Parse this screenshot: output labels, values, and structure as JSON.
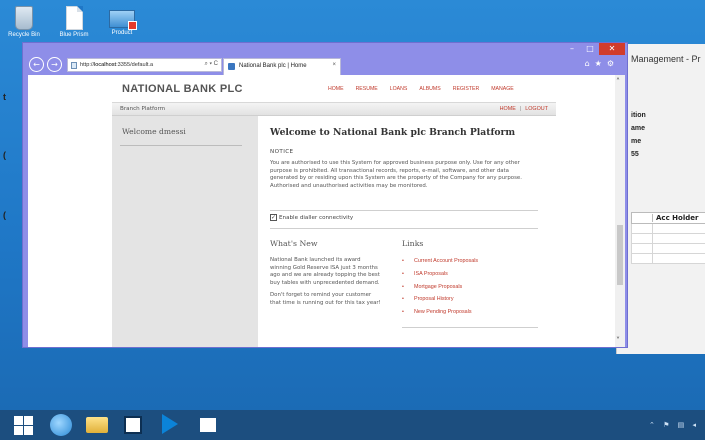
{
  "desktop": {
    "icons": [
      {
        "label": "Recycle Bin"
      },
      {
        "label": "Blue Prism"
      },
      {
        "label": "Product"
      }
    ]
  },
  "background_app": {
    "title": "Management - Pr",
    "words": [
      "ition",
      "ame",
      "me",
      "55"
    ],
    "grid_header": "Acc Holder"
  },
  "browser": {
    "address": {
      "prefix": "http://",
      "host": "localhost",
      "path": ":3355/default.a",
      "tools": "⌕ ▾ C"
    },
    "tab_title": "National Bank plc | Home",
    "tab_close": "×",
    "window_controls": {
      "minimize": "–",
      "maximize": "□",
      "close": "✕"
    },
    "nav": {
      "back": "←",
      "forward": "→"
    },
    "toolbar_icons": "⌂★⚙"
  },
  "site": {
    "logo": "NATIONAL BANK PLC",
    "nav": [
      "HOME",
      "RESUME",
      "LOANS",
      "ALBUMS",
      "REGISTER",
      "MANAGE"
    ],
    "subbar": {
      "brand": "Branch Platform",
      "home": "HOME",
      "separator": "|",
      "logout": "LOGOUT"
    },
    "sidebar": {
      "welcome": "Welcome dmessi"
    },
    "content": {
      "title": "Welcome to National Bank plc Branch Platform",
      "notice_label": "NOTICE",
      "notice_text": "You are authorised to use this System for approved business purpose only. Use for any other purpose is prohibited. All transactional records, reports, e-mail, software, and other data generated by or residing upon this System are the property of the Company for any purpose. Authorised and unauthorised activities may be monitored.",
      "checkbox_label": "Enable dialler connectivity",
      "checkbox_checked": true,
      "whats_new_heading": "What's New",
      "news_1": "National Bank launched its award winning Gold Reserve ISA just 3 months ago and we are already topping the best buy tables with unprecedented demand.",
      "news_2": "Don't forget to remind your customer that time is running out for this tax year!",
      "links_heading": "Links",
      "links": [
        "Current Account Proposals",
        "ISA Proposals",
        "Mortgage Proposals",
        "Proposal History",
        "New Pending Proposals"
      ]
    }
  },
  "taskbar": {
    "tray": "⌃ ⚑ ▤ ◂"
  },
  "colors": {
    "desktop": "#1f77c6",
    "browser_frame": "#8e8ee8",
    "link_red": "#c0392b",
    "taskbar": "#1c4e7f"
  }
}
